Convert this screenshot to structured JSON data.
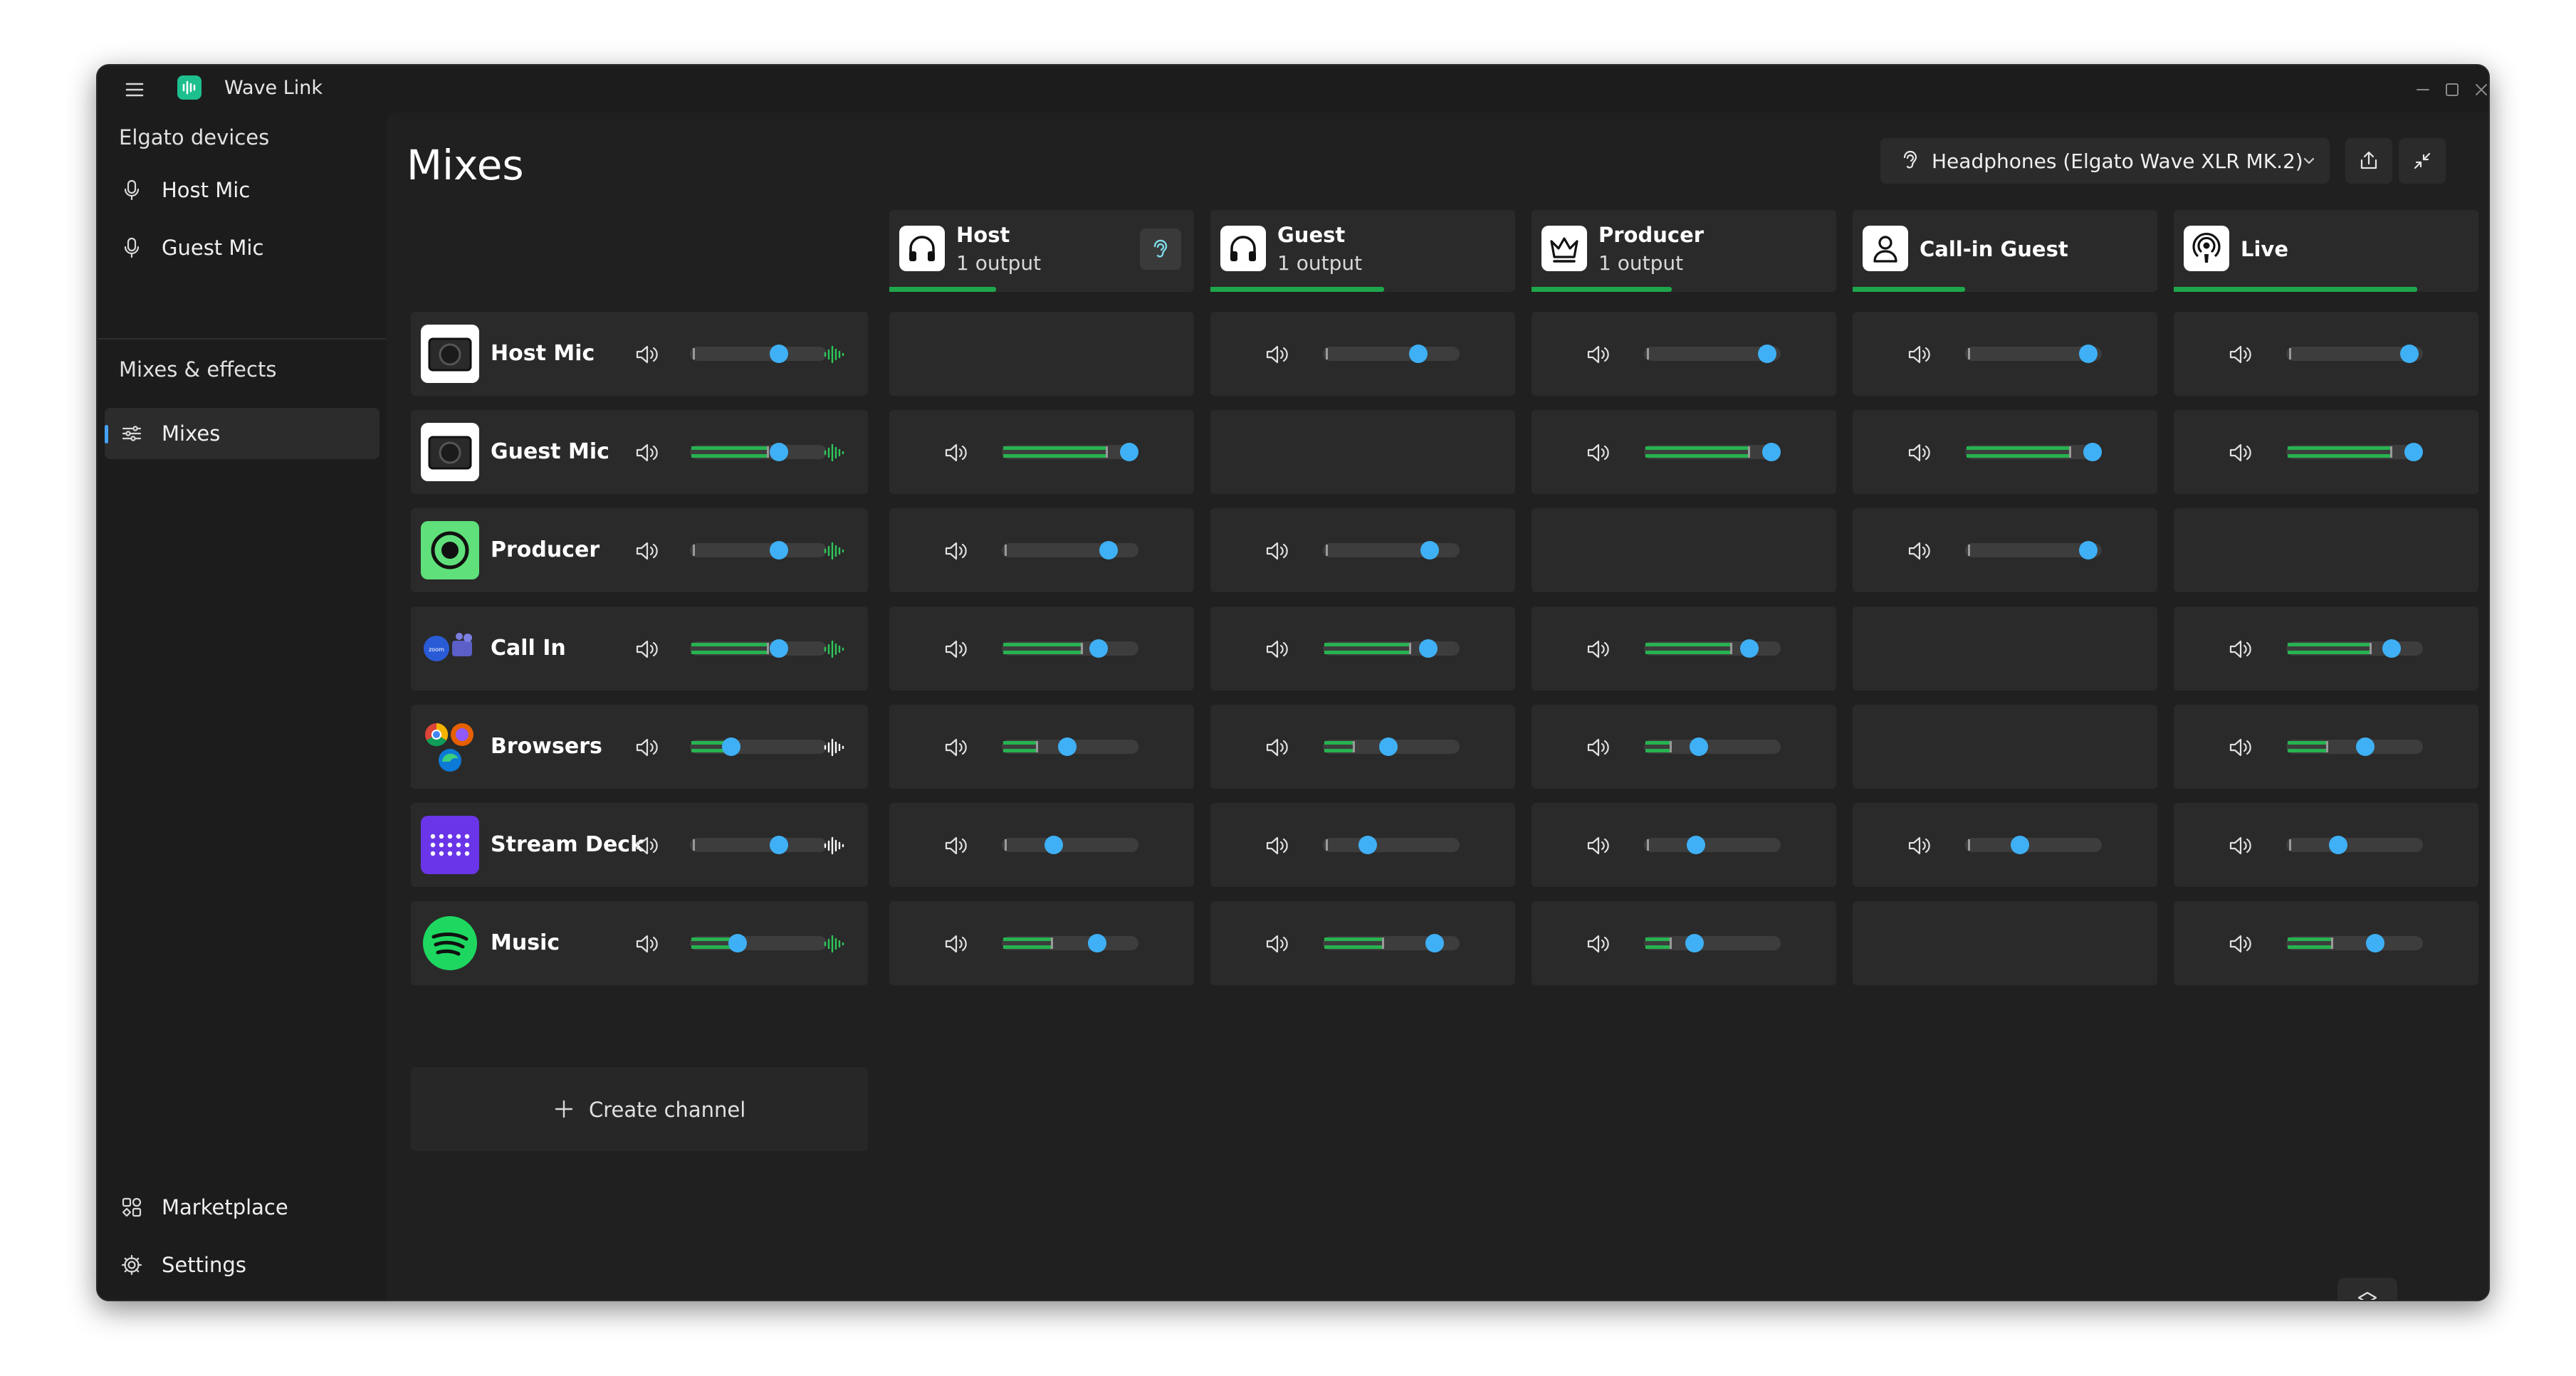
{
  "window": {
    "title": "Wave Link"
  },
  "sidebar": {
    "section_devices": "Elgato devices",
    "devices": [
      {
        "label": "Host Mic",
        "icon": "microphone-icon"
      },
      {
        "label": "Guest Mic",
        "icon": "microphone-icon"
      }
    ],
    "section_mixes": "Mixes & effects",
    "mixes_item": {
      "label": "Mixes",
      "icon": "sliders-icon",
      "active": true
    },
    "bottom": [
      {
        "label": "Marketplace",
        "icon": "marketplace-icon"
      },
      {
        "label": "Settings",
        "icon": "gear-icon"
      }
    ]
  },
  "main": {
    "title": "Mixes",
    "output_device": "Headphones (Elgato Wave XLR MK.2)",
    "create_channel": "Create channel"
  },
  "colors": {
    "accent": "#3fb0f5",
    "meter": "#27b350",
    "window_bg": "#1c1c1c",
    "panel": "#2a2a2a"
  },
  "mixes": [
    {
      "name": "Host",
      "sub": "1 output",
      "icon": "headphones-icon",
      "meter": 0.35,
      "listen": true
    },
    {
      "name": "Guest",
      "sub": "1 output",
      "icon": "headphones-icon",
      "meter": 0.57
    },
    {
      "name": "Producer",
      "sub": "1 output",
      "icon": "crown-icon",
      "meter": 0.46
    },
    {
      "name": "Call-in Guest",
      "sub": "",
      "icon": "person-icon",
      "meter": 0.37
    },
    {
      "name": "Live",
      "sub": "",
      "icon": "broadcast-icon",
      "meter": 0.8
    }
  ],
  "channels": [
    {
      "name": "Host Mic",
      "icon": "host-mic-device-icon",
      "level": 0.65,
      "meter": 0,
      "cells": [
        null,
        {
          "level": 0.7,
          "meter": 0
        },
        {
          "level": 0.9,
          "meter": 0
        },
        {
          "level": 0.9,
          "meter": 0
        },
        {
          "level": 0.9,
          "meter": 0
        }
      ]
    },
    {
      "name": "Guest Mic",
      "icon": "guest-mic-device-icon",
      "level": 0.65,
      "meter": 0.55,
      "cells": [
        {
          "level": 0.93,
          "meter": 0.75
        },
        null,
        {
          "level": 0.93,
          "meter": 0.75
        },
        {
          "level": 0.93,
          "meter": 0.75
        },
        {
          "level": 0.93,
          "meter": 0.75
        }
      ]
    },
    {
      "name": "Producer",
      "icon": "producer-icon",
      "level": 0.65,
      "meter": 0,
      "cells": [
        {
          "level": 0.78,
          "meter": 0
        },
        {
          "level": 0.78,
          "meter": 0
        },
        null,
        {
          "level": 0.9,
          "meter": 0
        },
        null
      ]
    },
    {
      "name": "Call In",
      "icon": "call-in-apps-icon",
      "level": 0.65,
      "meter": 0.55,
      "cells": [
        {
          "level": 0.71,
          "meter": 0.57
        },
        {
          "level": 0.77,
          "meter": 0.62
        },
        {
          "level": 0.77,
          "meter": 0.62
        },
        null,
        {
          "level": 0.77,
          "meter": 0.6
        }
      ]
    },
    {
      "name": "Browsers",
      "icon": "browsers-icon",
      "level": 0.3,
      "meter": 0.3,
      "cells": [
        {
          "level": 0.48,
          "meter": 0.24
        },
        {
          "level": 0.48,
          "meter": 0.21
        },
        {
          "level": 0.4,
          "meter": 0.18
        },
        null,
        {
          "level": 0.58,
          "meter": 0.28
        }
      ]
    },
    {
      "name": "Stream Deck",
      "icon": "stream-deck-icon",
      "level": 0.65,
      "meter": 0,
      "cells": [
        {
          "level": 0.38,
          "meter": 0
        },
        {
          "level": 0.33,
          "meter": 0
        },
        {
          "level": 0.38,
          "meter": 0
        },
        {
          "level": 0.4,
          "meter": 0
        },
        {
          "level": 0.38,
          "meter": 0
        }
      ]
    },
    {
      "name": "Music",
      "icon": "spotify-icon",
      "level": 0.35,
      "meter": 0.35,
      "cells": [
        {
          "level": 0.7,
          "meter": 0.35
        },
        {
          "level": 0.82,
          "meter": 0.42
        },
        {
          "level": 0.37,
          "meter": 0.18
        },
        null,
        {
          "level": 0.65,
          "meter": 0.32
        }
      ]
    }
  ]
}
